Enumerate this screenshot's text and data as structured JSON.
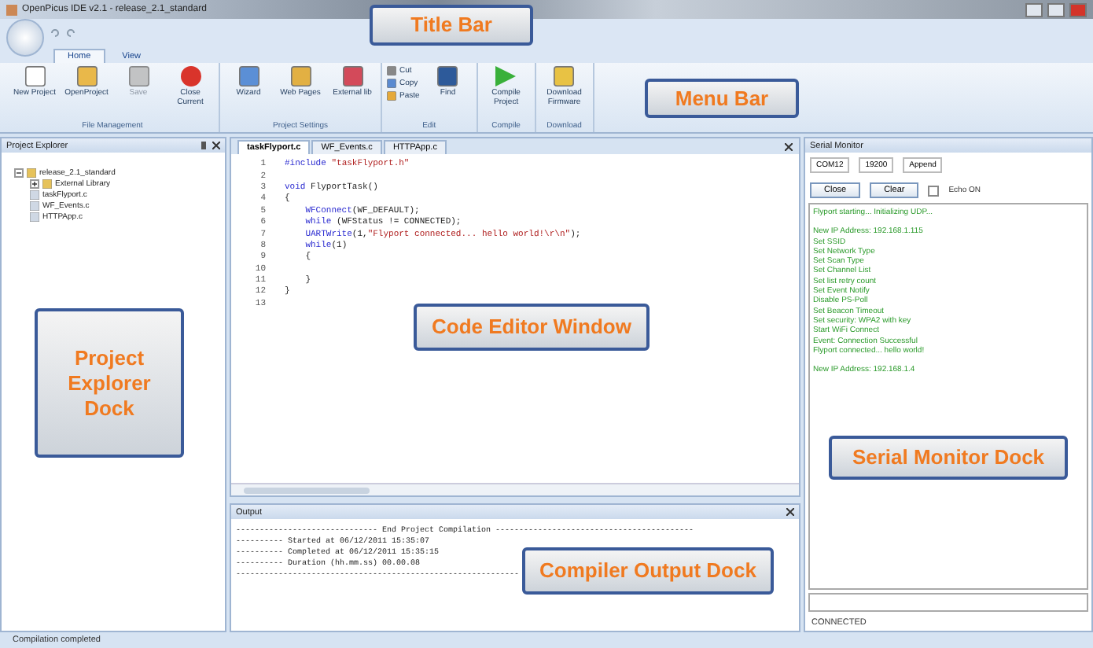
{
  "window": {
    "title": "OpenPicus IDE v2.1 - release_2.1_standard"
  },
  "ribbon_tabs": [
    {
      "label": "Home",
      "selected": true
    },
    {
      "label": "View",
      "selected": false
    }
  ],
  "ribbon_groups": [
    {
      "label": "File Management",
      "buttons": [
        {
          "label": "New Project",
          "kind": "large",
          "disabled": false
        },
        {
          "label": "OpenProject",
          "kind": "large",
          "disabled": false
        },
        {
          "label": "Save",
          "kind": "large",
          "disabled": true
        },
        {
          "label": "Close Current",
          "kind": "large",
          "disabled": false
        }
      ]
    },
    {
      "label": "Project Settings",
      "buttons": [
        {
          "label": "Wizard",
          "kind": "large",
          "disabled": false
        },
        {
          "label": "Web Pages",
          "kind": "large",
          "disabled": false
        },
        {
          "label": "External lib",
          "kind": "large",
          "disabled": false
        }
      ]
    },
    {
      "label": "Edit",
      "buttons": [
        {
          "label": "Cut",
          "kind": "small",
          "disabled": false
        },
        {
          "label": "Copy",
          "kind": "small",
          "disabled": false
        },
        {
          "label": "Paste",
          "kind": "small",
          "disabled": false
        },
        {
          "label": "Find",
          "kind": "large",
          "disabled": false
        }
      ]
    },
    {
      "label": "Compile",
      "buttons": [
        {
          "label": "Compile Project",
          "kind": "large",
          "disabled": false
        }
      ]
    },
    {
      "label": "Download",
      "buttons": [
        {
          "label": "Download Firmware",
          "kind": "large",
          "disabled": false
        }
      ]
    }
  ],
  "project_explorer": {
    "title": "Project Explorer",
    "tree": [
      {
        "label": "release_2.1_standard",
        "expanded": true,
        "children": [
          {
            "label": "External Library",
            "expanded": false
          },
          {
            "label": "taskFlyport.c"
          },
          {
            "label": "WF_Events.c"
          },
          {
            "label": "HTTPApp.c"
          }
        ]
      }
    ]
  },
  "editor": {
    "tabs": [
      {
        "label": "taskFlyport.c",
        "selected": true
      },
      {
        "label": "WF_Events.c",
        "selected": false
      },
      {
        "label": "HTTPApp.c",
        "selected": false
      }
    ],
    "lines": [
      {
        "number": "1",
        "segments": [
          {
            "text": "#include ",
            "kind": "keyword"
          },
          {
            "text": "\"taskFlyport.h\"",
            "kind": "string"
          }
        ]
      },
      {
        "number": "2"
      },
      {
        "number": "3",
        "segments": [
          {
            "text": "void ",
            "kind": "keyword"
          },
          {
            "text": "FlyportTask()",
            "kind": "plain"
          }
        ]
      },
      {
        "number": "4",
        "segments": [
          {
            "text": "{",
            "kind": "plain"
          }
        ]
      },
      {
        "number": "5",
        "segments": [
          {
            "text": "    WFConnect",
            "kind": "keyword"
          },
          {
            "text": "(WF_DEFAULT);",
            "kind": "plain"
          }
        ]
      },
      {
        "number": "6",
        "segments": [
          {
            "text": "    while ",
            "kind": "keyword"
          },
          {
            "text": "(WFStatus != CONNECTED);",
            "kind": "plain"
          }
        ]
      },
      {
        "number": "7",
        "segments": [
          {
            "text": "    UARTWrite",
            "kind": "keyword"
          },
          {
            "text": "(1,",
            "kind": "plain"
          },
          {
            "text": "\"Flyport connected... hello world!\\r\\n\"",
            "kind": "string"
          },
          {
            "text": ");",
            "kind": "plain"
          }
        ]
      },
      {
        "number": "8",
        "segments": [
          {
            "text": "    while",
            "kind": "keyword"
          },
          {
            "text": "(1)",
            "kind": "plain"
          }
        ]
      },
      {
        "number": "9",
        "segments": [
          {
            "text": "    {",
            "kind": "plain"
          }
        ]
      },
      {
        "number": "10"
      },
      {
        "number": "11",
        "segments": [
          {
            "text": "    }",
            "kind": "plain"
          }
        ]
      },
      {
        "number": "12",
        "segments": [
          {
            "text": "}",
            "kind": "plain"
          }
        ]
      },
      {
        "number": "13"
      }
    ]
  },
  "output": {
    "title": "Output",
    "lines": [
      "------------------------------ End Project Compilation ------------------------------------------",
      "---------- Started at 06/12/2011 15:35:07",
      "---------- Completed at 06/12/2011 15:35:15",
      "---------- Duration (hh.mm.ss) 00.00.08",
      "------------------------------------------------------------"
    ]
  },
  "serial_monitor": {
    "title": "Serial Monitor",
    "port": "COM12",
    "baud": "19200",
    "mode": "Append",
    "buttons": [
      "Close",
      "Clear"
    ],
    "echo": {
      "label": "Echo ON",
      "checked": false
    },
    "blocks": [
      [
        "Flyport starting... Initializing UDP..."
      ],
      [
        "New IP Address: 192.168.1.115",
        "Set SSID",
        "Set Network Type",
        "Set Scan Type",
        "Set Channel List",
        "Set list retry count",
        "Set Event Notify",
        "Disable PS-Poll",
        "Set Beacon Timeout",
        "Set security: WPA2 with key",
        "Start WiFi Connect",
        "Event: Connection Successful",
        "Flyport connected... hello world!"
      ],
      [
        "New IP Address: 192.168.1.4"
      ]
    ],
    "status": "CONNECTED"
  },
  "status_bar": "Compilation completed",
  "callouts": [
    {
      "label": "Title Bar"
    },
    {
      "label": "Menu Bar"
    },
    {
      "label": "Project Explorer Dock"
    },
    {
      "label": "Code Editor Window"
    },
    {
      "label": "Serial Monitor Dock"
    },
    {
      "label": "Compiler Output Dock"
    }
  ]
}
